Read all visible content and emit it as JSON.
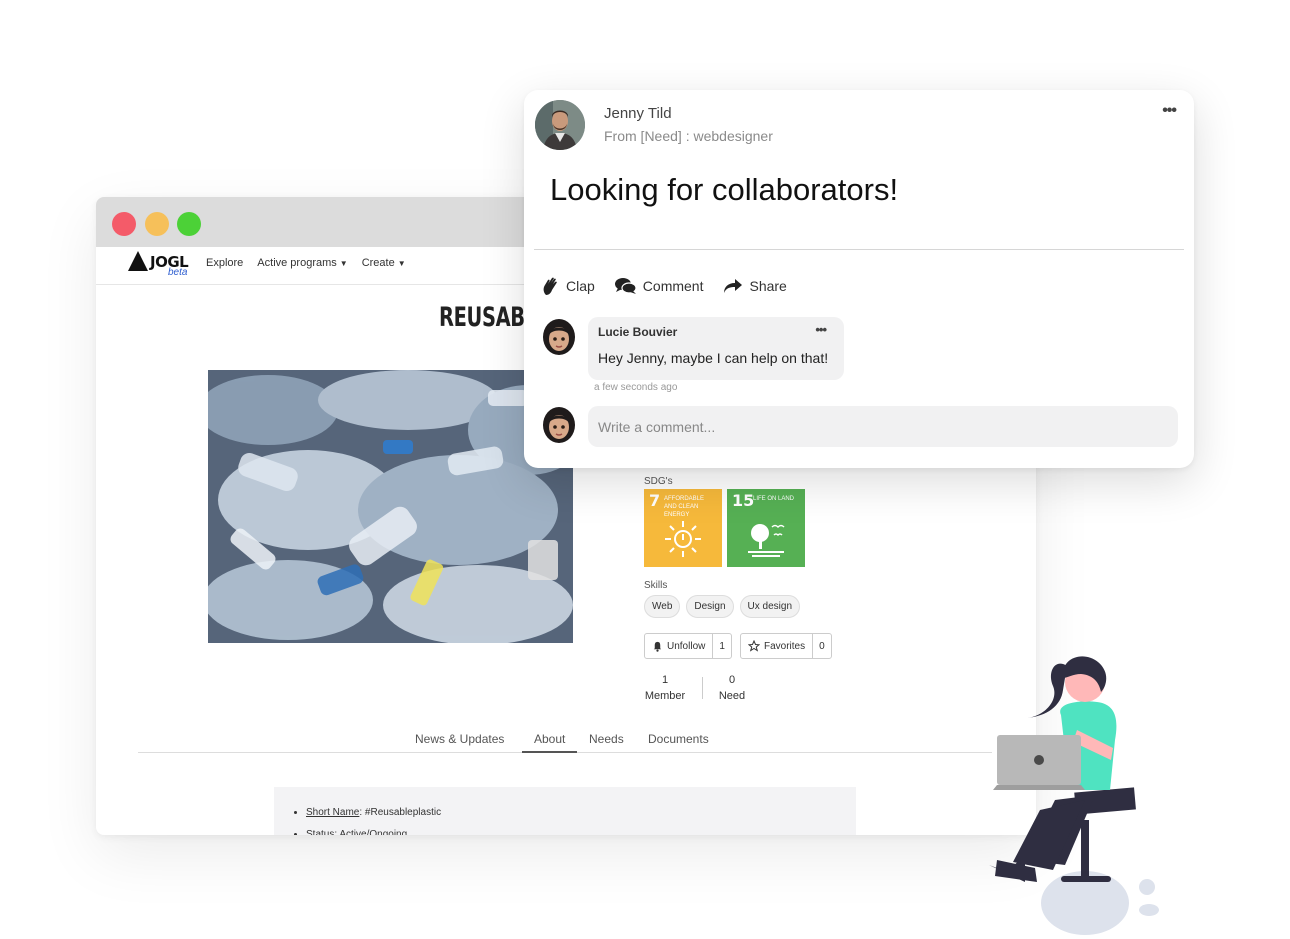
{
  "browser": {
    "logo_text": "JOGL",
    "logo_beta": "beta",
    "nav": {
      "explore": "Explore",
      "programs": "Active programs",
      "create": "Create"
    },
    "project_title": "REUSABL",
    "sdg_label": "SDG's",
    "sdgs": [
      {
        "number": "7",
        "text": "AFFORDABLE AND CLEAN ENERGY",
        "color": "#f6b93b"
      },
      {
        "number": "15",
        "text": "LIFE ON LAND",
        "color": "#56b054"
      }
    ],
    "skills_label": "Skills",
    "skills": [
      "Web",
      "Design",
      "Ux design"
    ],
    "unfollow": {
      "label": "Unfollow",
      "count": "1"
    },
    "favorites": {
      "label": "Favorites",
      "count": "0"
    },
    "stats": {
      "members": {
        "value": "1",
        "label": "Member"
      },
      "needs": {
        "value": "0",
        "label": "Need"
      }
    },
    "tabs": [
      "News & Updates",
      "About",
      "Needs",
      "Documents"
    ],
    "active_tab": "About",
    "about": {
      "short_name_label": "Short Name",
      "short_name_value": ": #Reusableplastic",
      "status": "Status: Active/Ongoing"
    }
  },
  "post": {
    "author": "Jenny Tild",
    "from": "From [Need] : webdesigner",
    "text": "Looking for collaborators!",
    "actions": {
      "clap": "Clap",
      "comment": "Comment",
      "share": "Share"
    },
    "comment": {
      "author": "Lucie Bouvier",
      "text": "Hey Jenny, maybe I can help on that!",
      "time": "a few seconds ago"
    },
    "input_placeholder": "Write a comment..."
  },
  "colors": {
    "dot_red": "#f45b69",
    "dot_yellow": "#f6c05a",
    "dot_green": "#4cd137",
    "shirt": "#4fe3c1",
    "hair": "#2f2e41"
  }
}
